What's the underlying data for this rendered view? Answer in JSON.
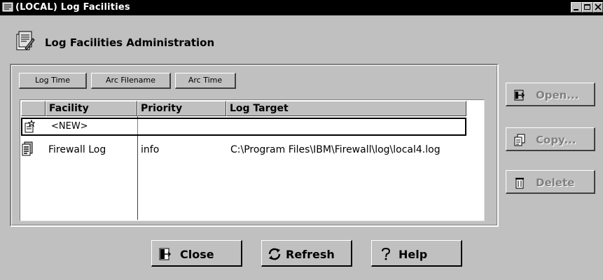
{
  "window": {
    "title": "(LOCAL) Log Facilities",
    "minimize_icon": "minimize-icon",
    "maximize_icon": "maximize-icon",
    "close_icon": "close-icon"
  },
  "header": {
    "title": "Log Facilities Administration",
    "icon": "log-facilities-icon"
  },
  "toolbar": {
    "buttons": [
      "Log Time",
      "Arc Filename",
      "Arc Time"
    ]
  },
  "table": {
    "columns": [
      "Facility",
      "Priority",
      "Log Target"
    ],
    "new_row_label": "<NEW>",
    "rows": [
      {
        "facility": "Firewall Log",
        "priority": "info",
        "log_target": "C:\\Program Files\\IBM\\Firewall\\log\\local4.log"
      }
    ]
  },
  "side_buttons": {
    "open": "Open...",
    "copy": "Copy...",
    "delete": "Delete"
  },
  "bottom_buttons": {
    "close": "Close",
    "refresh": "Refresh",
    "help": "Help"
  },
  "colors": {
    "titlebar": "#000000",
    "face": "#c0c0c0",
    "disabled_text": "#808080"
  }
}
